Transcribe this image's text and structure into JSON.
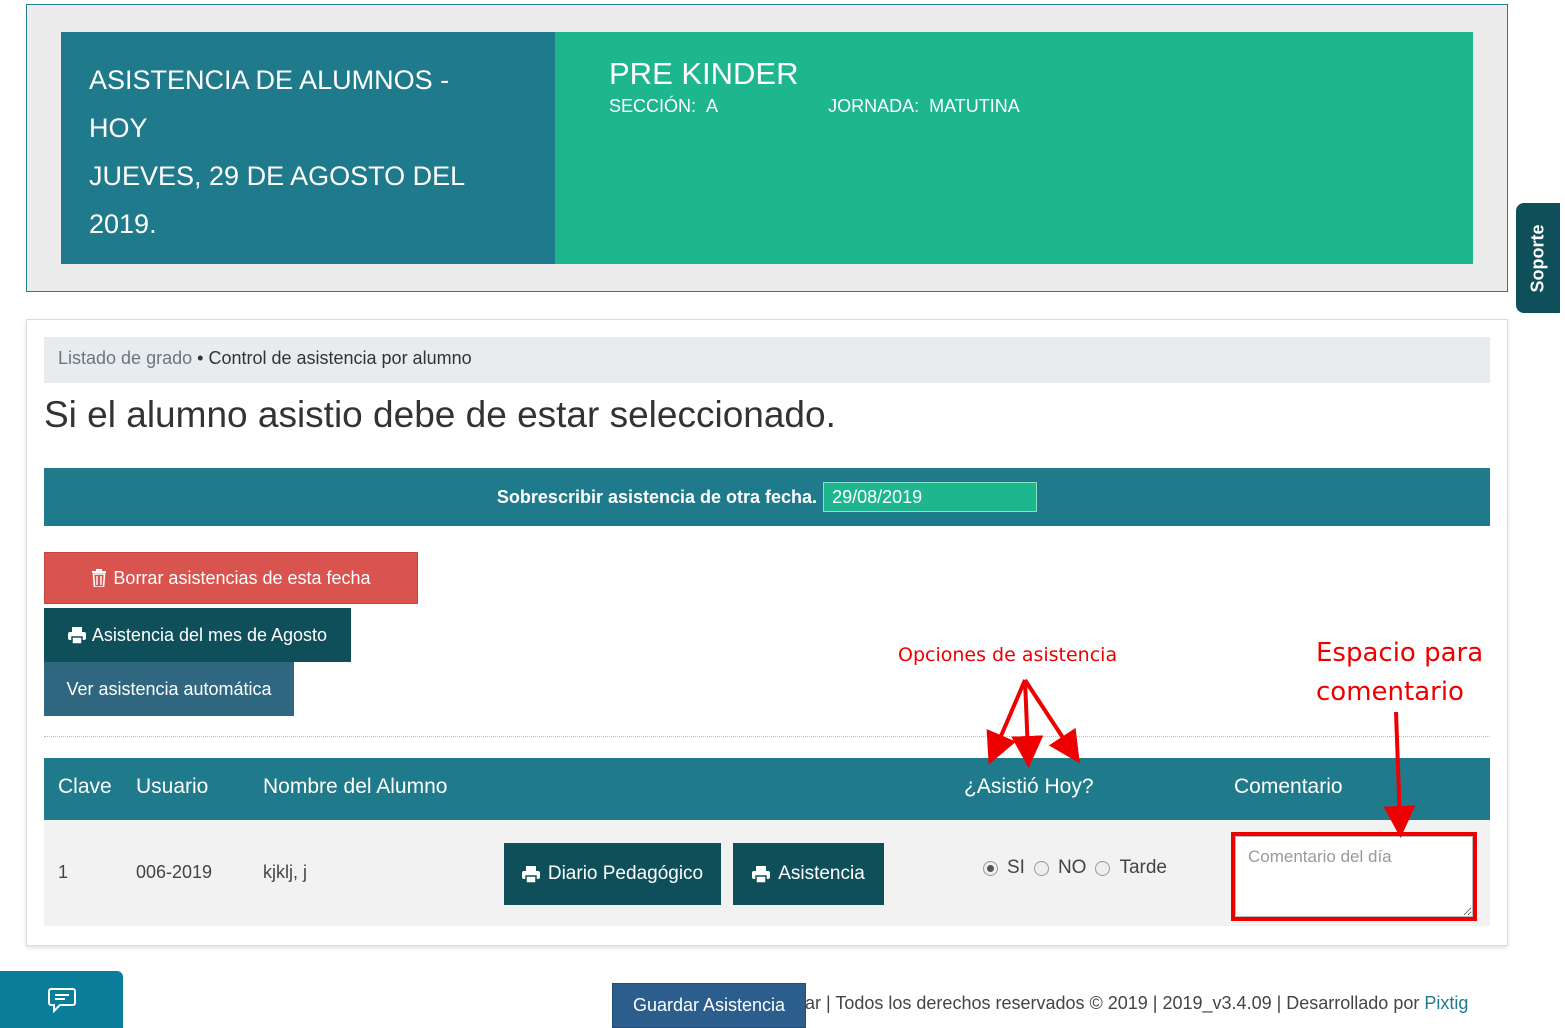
{
  "header": {
    "title_lines": [
      "ASISTENCIA DE ALUMNOS -",
      "HOY",
      "JUEVES, 29 DE AGOSTO DEL",
      "2019."
    ],
    "grade": "PRE KINDER",
    "section_label": "SECCIÓN:",
    "section_value": "A",
    "shift_label": "JORNADA:",
    "shift_value": "MATUTINA"
  },
  "support_tab": "Soporte",
  "breadcrumb": {
    "link": "Listado de grado",
    "separator": "•",
    "current": "Control de asistencia por alumno"
  },
  "headline": "Si el alumno asistio debe de estar seleccionado.",
  "date_override": {
    "label": "Sobrescribir asistencia de otra fecha.",
    "value": "29/08/2019"
  },
  "actions": {
    "delete": "Borrar asistencias de esta fecha",
    "month": "Asistencia del mes de Agosto",
    "auto": "Ver asistencia automática"
  },
  "table": {
    "headers": {
      "clave": "Clave",
      "usuario": "Usuario",
      "nombre": "Nombre del Alumno",
      "asistio": "¿Asistió Hoy?",
      "comentario": "Comentario"
    },
    "rows": [
      {
        "clave": "1",
        "usuario": "006-2019",
        "nombre": "kjklj, j",
        "diario": "Diario Pedagógico",
        "asistencia": "Asistencia",
        "opt_si": "SI",
        "opt_no": "NO",
        "opt_tarde": "Tarde",
        "comment_placeholder": "Comentario del día"
      }
    ]
  },
  "annotations": {
    "options": "Opciones de asistencia",
    "space_line1": "Espacio para",
    "space_line2": "comentario"
  },
  "footer": {
    "save": "Guardar Asistencia",
    "partial": "ar",
    "rights": " | Todos los derechos reservados © 2019 | 2019_v3.4.09 | Desarrollado por ",
    "brand": "Pixtig"
  },
  "colors": {
    "teal": "#1f7a8c",
    "green": "#1eb68e",
    "dark_teal": "#0e4f5a",
    "red": "#d9534f",
    "annotation": "#ee0000"
  }
}
